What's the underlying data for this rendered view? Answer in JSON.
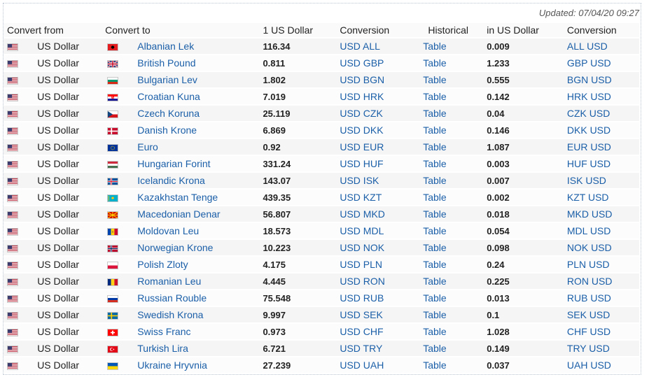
{
  "updated_text": "Updated: 07/04/20 09:27",
  "headers": {
    "convert_from": "Convert from",
    "convert_to": "Convert to",
    "rate": "1 US Dollar",
    "conversion": "Conversion",
    "historical": "Historical",
    "inverse": "in US Dollar",
    "inverse_conversion": "Conversion"
  },
  "from_currency": "US Dollar",
  "rows": [
    {
      "to": "Albanian Lek",
      "flag": "al",
      "rate": "116.34",
      "conv": "USD ALL",
      "hist": "Table",
      "inv": "0.009",
      "rconv": "ALL USD"
    },
    {
      "to": "British Pound",
      "flag": "gb",
      "rate": "0.811",
      "conv": "USD GBP",
      "hist": "Table",
      "inv": "1.233",
      "rconv": "GBP USD"
    },
    {
      "to": "Bulgarian Lev",
      "flag": "bg",
      "rate": "1.802",
      "conv": "USD BGN",
      "hist": "Table",
      "inv": "0.555",
      "rconv": "BGN USD"
    },
    {
      "to": "Croatian Kuna",
      "flag": "hr",
      "rate": "7.019",
      "conv": "USD HRK",
      "hist": "Table",
      "inv": "0.142",
      "rconv": "HRK USD"
    },
    {
      "to": "Czech Koruna",
      "flag": "cz",
      "rate": "25.119",
      "conv": "USD CZK",
      "hist": "Table",
      "inv": "0.04",
      "rconv": "CZK USD"
    },
    {
      "to": "Danish Krone",
      "flag": "dk",
      "rate": "6.869",
      "conv": "USD DKK",
      "hist": "Table",
      "inv": "0.146",
      "rconv": "DKK USD"
    },
    {
      "to": "Euro",
      "flag": "eu",
      "rate": "0.92",
      "conv": "USD EUR",
      "hist": "Table",
      "inv": "1.087",
      "rconv": "EUR USD"
    },
    {
      "to": "Hungarian Forint",
      "flag": "hu",
      "rate": "331.24",
      "conv": "USD HUF",
      "hist": "Table",
      "inv": "0.003",
      "rconv": "HUF USD"
    },
    {
      "to": "Icelandic Krona",
      "flag": "is",
      "rate": "143.07",
      "conv": "USD ISK",
      "hist": "Table",
      "inv": "0.007",
      "rconv": "ISK USD"
    },
    {
      "to": "Kazakhstan Tenge",
      "flag": "kz",
      "rate": "439.35",
      "conv": "USD KZT",
      "hist": "Table",
      "inv": "0.002",
      "rconv": "KZT USD"
    },
    {
      "to": "Macedonian Denar",
      "flag": "mk",
      "rate": "56.807",
      "conv": "USD MKD",
      "hist": "Table",
      "inv": "0.018",
      "rconv": "MKD USD"
    },
    {
      "to": "Moldovan Leu",
      "flag": "md",
      "rate": "18.573",
      "conv": "USD MDL",
      "hist": "Table",
      "inv": "0.054",
      "rconv": "MDL USD"
    },
    {
      "to": "Norwegian Krone",
      "flag": "no",
      "rate": "10.223",
      "conv": "USD NOK",
      "hist": "Table",
      "inv": "0.098",
      "rconv": "NOK USD"
    },
    {
      "to": "Polish Zloty",
      "flag": "pl",
      "rate": "4.175",
      "conv": "USD PLN",
      "hist": "Table",
      "inv": "0.24",
      "rconv": "PLN USD"
    },
    {
      "to": "Romanian Leu",
      "flag": "ro",
      "rate": "4.445",
      "conv": "USD RON",
      "hist": "Table",
      "inv": "0.225",
      "rconv": "RON USD"
    },
    {
      "to": "Russian Rouble",
      "flag": "ru",
      "rate": "75.548",
      "conv": "USD RUB",
      "hist": "Table",
      "inv": "0.013",
      "rconv": "RUB USD"
    },
    {
      "to": "Swedish Krona",
      "flag": "se",
      "rate": "9.997",
      "conv": "USD SEK",
      "hist": "Table",
      "inv": "0.1",
      "rconv": "SEK USD"
    },
    {
      "to": "Swiss Franc",
      "flag": "ch",
      "rate": "0.973",
      "conv": "USD CHF",
      "hist": "Table",
      "inv": "1.028",
      "rconv": "CHF USD"
    },
    {
      "to": "Turkish Lira",
      "flag": "tr",
      "rate": "6.721",
      "conv": "USD TRY",
      "hist": "Table",
      "inv": "0.149",
      "rconv": "TRY USD"
    },
    {
      "to": "Ukraine Hryvnia",
      "flag": "ua",
      "rate": "27.239",
      "conv": "USD UAH",
      "hist": "Table",
      "inv": "0.037",
      "rconv": "UAH USD"
    }
  ],
  "colors": {
    "link": "#1b5fa8",
    "row_odd": "#f5f5f5",
    "row_even": "#fcfcfc"
  }
}
